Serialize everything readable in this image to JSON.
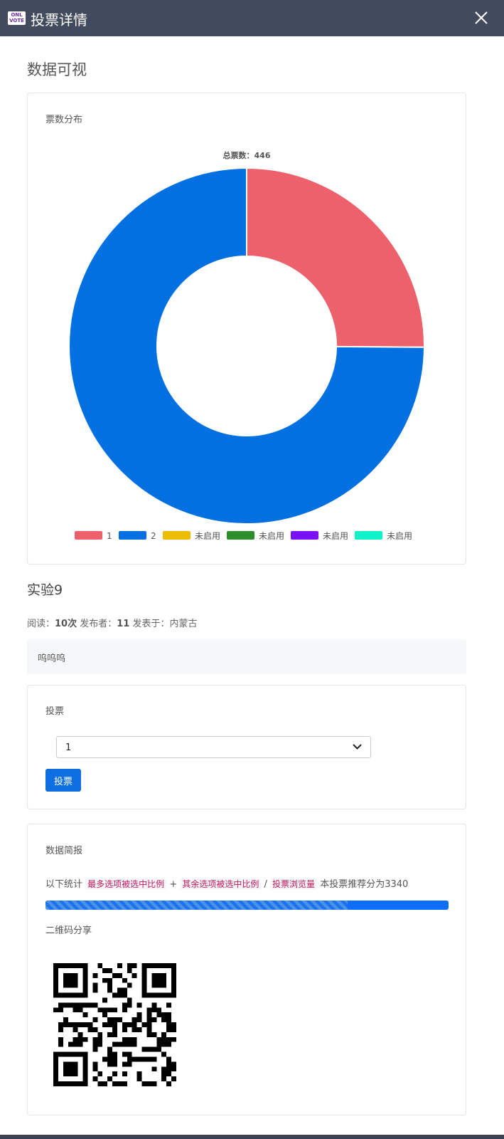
{
  "window": {
    "title": "投票详情",
    "logo_text": "ONLINE VOTE"
  },
  "section": {
    "title": "数据可视"
  },
  "chart_card": {
    "label": "票数分布"
  },
  "chart_data": {
    "type": "pie",
    "title": "总票数：446",
    "total": 446,
    "slices": [
      {
        "label": "1",
        "value": 112,
        "color": "#ec616b"
      },
      {
        "label": "2",
        "value": 334,
        "color": "#0270e0"
      }
    ],
    "legend": [
      {
        "label": "1",
        "color": "#ec616b"
      },
      {
        "label": "2",
        "color": "#0270e0"
      },
      {
        "label": "未启用",
        "color": "#f0bb05"
      },
      {
        "label": "未启用",
        "color": "#2c8f2c"
      },
      {
        "label": "未启用",
        "color": "#7a11f5"
      },
      {
        "label": "未启用",
        "color": "#0ff2c9"
      }
    ],
    "legend_position": "bottom"
  },
  "post": {
    "title": "实验9",
    "read_label": "阅读：",
    "read_value": "10次",
    "publisher_label": "发布者：",
    "publisher_value": "11",
    "published_from": "发表于：内蒙古",
    "description": "呜呜呜"
  },
  "vote_card": {
    "label": "投票",
    "selected": "1",
    "button": "投票"
  },
  "report_card": {
    "label": "数据简报",
    "prefix": "以下统计",
    "code1": "最多选项被选中比例",
    "plus": "+",
    "code2": "其余选项被选中比例",
    "slash": "/",
    "code3": "投票浏览量",
    "score_text": "本投票推荐分为3340",
    "progress": 0.75,
    "qr_label": "二维码分享"
  },
  "colors": {
    "accent": "#0d6efd",
    "titlebar": "#424a5e"
  }
}
